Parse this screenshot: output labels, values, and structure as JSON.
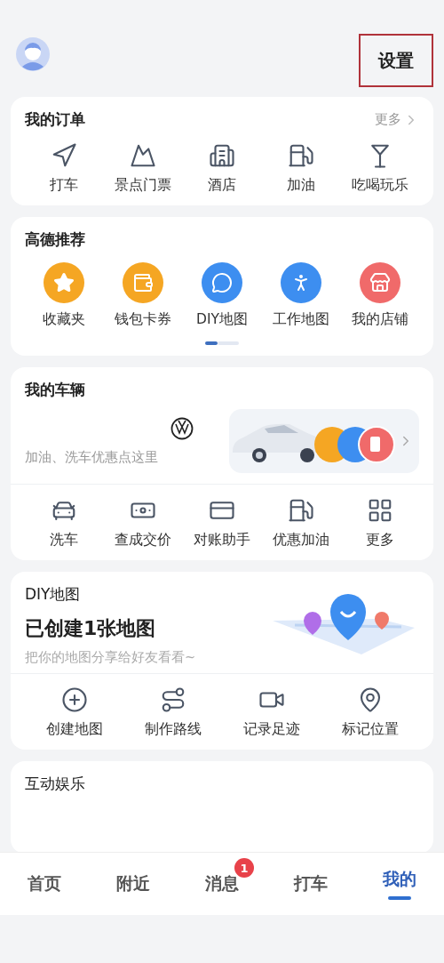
{
  "header": {
    "settings_button": {
      "label": "设置",
      "highlighted": true
    }
  },
  "orders": {
    "title": "我的订单",
    "more": "更多",
    "items": [
      {
        "label": "打车"
      },
      {
        "label": "景点门票"
      },
      {
        "label": "酒店"
      },
      {
        "label": "加油"
      },
      {
        "label": "吃喝玩乐"
      }
    ]
  },
  "recommend": {
    "title": "高德推荐",
    "items": [
      {
        "label": "收藏夹",
        "color": "#f5a623"
      },
      {
        "label": "钱包卡券",
        "color": "#f5a623"
      },
      {
        "label": "DIY地图",
        "color": "#3d8ef0"
      },
      {
        "label": "工作地图",
        "color": "#3d8ef0"
      },
      {
        "label": "我的店铺",
        "color": "#f06a6a"
      }
    ],
    "pager": [
      {
        "selected": true
      },
      {
        "selected": false
      }
    ]
  },
  "vehicle": {
    "title": "我的车辆",
    "hint": "加油、洗车优惠点这里",
    "tools": [
      {
        "label": "洗车"
      },
      {
        "label": "查成交价"
      },
      {
        "label": "对账助手"
      },
      {
        "label": "优惠加油"
      },
      {
        "label": "更多"
      }
    ]
  },
  "diy_map": {
    "title": "DIY地图",
    "headline": "已创建1张地图",
    "subtitle": "把你的地图分享给好友看看~",
    "actions": [
      {
        "label": "创建地图"
      },
      {
        "label": "制作路线"
      },
      {
        "label": "记录足迹"
      },
      {
        "label": "标记位置"
      }
    ]
  },
  "fun": {
    "title": "互动娱乐"
  },
  "tab_bar": [
    {
      "label": "首页",
      "selected": false
    },
    {
      "label": "附近",
      "selected": false
    },
    {
      "label": "消息",
      "selected": false,
      "badge": "1"
    },
    {
      "label": "打车",
      "selected": false
    },
    {
      "label": "我的",
      "selected": true
    }
  ]
}
